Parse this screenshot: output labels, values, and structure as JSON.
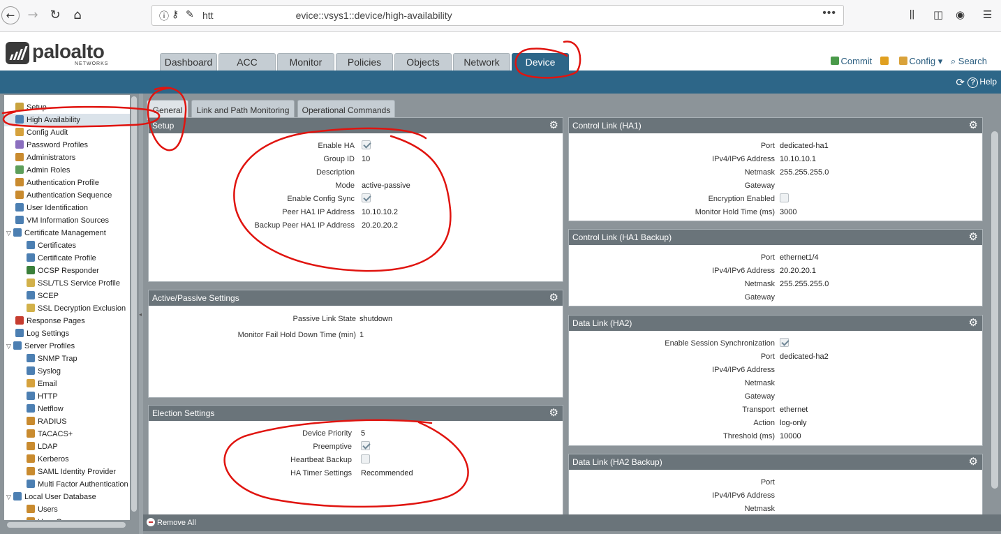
{
  "browser": {
    "url_prefix": "htt",
    "url_suffix": "evice::vsys1::device/high-availability",
    "more": "•••"
  },
  "logo": {
    "name": "paloalto",
    "sub": "NETWORKS"
  },
  "main_tabs": [
    "Dashboard",
    "ACC",
    "Monitor",
    "Policies",
    "Objects",
    "Network",
    "Device"
  ],
  "header_actions": {
    "commit": "Commit",
    "config": "Config",
    "search": "Search"
  },
  "help": "Help",
  "sidebar": {
    "items": [
      {
        "label": "Setup",
        "indent": 0
      },
      {
        "label": "High Availability",
        "indent": 0
      },
      {
        "label": "Config Audit",
        "indent": 0
      },
      {
        "label": "Password Profiles",
        "indent": 0
      },
      {
        "label": "Administrators",
        "indent": 0
      },
      {
        "label": "Admin Roles",
        "indent": 0
      },
      {
        "label": "Authentication Profile",
        "indent": 0
      },
      {
        "label": "Authentication Sequence",
        "indent": 0
      },
      {
        "label": "User Identification",
        "indent": 0
      },
      {
        "label": "VM Information Sources",
        "indent": 0
      },
      {
        "label": "Certificate Management",
        "indent": 0
      },
      {
        "label": "Certificates",
        "indent": 1
      },
      {
        "label": "Certificate Profile",
        "indent": 1
      },
      {
        "label": "OCSP Responder",
        "indent": 1
      },
      {
        "label": "SSL/TLS Service Profile",
        "indent": 1
      },
      {
        "label": "SCEP",
        "indent": 1
      },
      {
        "label": "SSL Decryption Exclusion",
        "indent": 1
      },
      {
        "label": "Response Pages",
        "indent": 0
      },
      {
        "label": "Log Settings",
        "indent": 0
      },
      {
        "label": "Server Profiles",
        "indent": 0
      },
      {
        "label": "SNMP Trap",
        "indent": 1
      },
      {
        "label": "Syslog",
        "indent": 1
      },
      {
        "label": "Email",
        "indent": 1
      },
      {
        "label": "HTTP",
        "indent": 1
      },
      {
        "label": "Netflow",
        "indent": 1
      },
      {
        "label": "RADIUS",
        "indent": 1
      },
      {
        "label": "TACACS+",
        "indent": 1
      },
      {
        "label": "LDAP",
        "indent": 1
      },
      {
        "label": "Kerberos",
        "indent": 1
      },
      {
        "label": "SAML Identity Provider",
        "indent": 1
      },
      {
        "label": "Multi Factor Authentication",
        "indent": 1
      },
      {
        "label": "Local User Database",
        "indent": 0
      },
      {
        "label": "Users",
        "indent": 1
      },
      {
        "label": "User Groups",
        "indent": 1
      }
    ]
  },
  "sub_tabs": [
    "General",
    "Link and Path Monitoring",
    "Operational Commands"
  ],
  "panels": {
    "setup": {
      "title": "Setup",
      "rows": [
        {
          "label": "Enable HA",
          "value": "",
          "checkbox": true
        },
        {
          "label": "Group ID",
          "value": "10"
        },
        {
          "label": "Description",
          "value": ""
        },
        {
          "label": "Mode",
          "value": "active-passive"
        },
        {
          "label": "Enable Config Sync",
          "value": "",
          "checkbox": true
        },
        {
          "label": "Peer HA1 IP Address",
          "value": "10.10.10.2"
        },
        {
          "label": "Backup Peer HA1 IP Address",
          "value": "20.20.20.2"
        }
      ]
    },
    "active_passive": {
      "title": "Active/Passive Settings",
      "rows": [
        {
          "label": "Passive Link State",
          "value": "shutdown"
        },
        {
          "label": "Monitor Fail Hold Down Time (min)",
          "value": "1"
        }
      ]
    },
    "election": {
      "title": "Election Settings",
      "rows": [
        {
          "label": "Device Priority",
          "value": "5"
        },
        {
          "label": "Preemptive",
          "value": "",
          "checkbox": true
        },
        {
          "label": "Heartbeat Backup",
          "value": "",
          "checkbox": false
        },
        {
          "label": "HA Timer Settings",
          "value": "Recommended"
        }
      ]
    },
    "ha1": {
      "title": "Control Link (HA1)",
      "rows": [
        {
          "label": "Port",
          "value": "dedicated-ha1"
        },
        {
          "label": "IPv4/IPv6 Address",
          "value": "10.10.10.1"
        },
        {
          "label": "Netmask",
          "value": "255.255.255.0"
        },
        {
          "label": "Gateway",
          "value": ""
        },
        {
          "label": "Encryption Enabled",
          "value": "",
          "checkbox": false
        },
        {
          "label": "Monitor Hold Time (ms)",
          "value": "3000"
        }
      ]
    },
    "ha1_backup": {
      "title": "Control Link (HA1 Backup)",
      "rows": [
        {
          "label": "Port",
          "value": "ethernet1/4"
        },
        {
          "label": "IPv4/IPv6 Address",
          "value": "20.20.20.1"
        },
        {
          "label": "Netmask",
          "value": "255.255.255.0"
        },
        {
          "label": "Gateway",
          "value": ""
        }
      ]
    },
    "ha2": {
      "title": "Data Link (HA2)",
      "rows": [
        {
          "label": "Enable Session Synchronization",
          "value": "",
          "checkbox": true
        },
        {
          "label": "Port",
          "value": "dedicated-ha2"
        },
        {
          "label": "IPv4/IPv6 Address",
          "value": ""
        },
        {
          "label": "Netmask",
          "value": ""
        },
        {
          "label": "Gateway",
          "value": ""
        },
        {
          "label": "Transport",
          "value": "ethernet"
        },
        {
          "label": "Action",
          "value": "log-only"
        },
        {
          "label": "Threshold (ms)",
          "value": "10000"
        }
      ]
    },
    "ha2_backup": {
      "title": "Data Link (HA2 Backup)",
      "rows": [
        {
          "label": "Port",
          "value": ""
        },
        {
          "label": "IPv4/IPv6 Address",
          "value": ""
        },
        {
          "label": "Netmask",
          "value": ""
        }
      ]
    }
  },
  "footer": {
    "remove_all": "Remove All"
  },
  "icons": {
    "gear": "gear-icon",
    "refresh": "refresh-icon",
    "help": "help-icon"
  },
  "colors": {
    "header_blue": "#2d6688",
    "panel_head": "#6a747a",
    "annotation_red": "#e0140f"
  }
}
